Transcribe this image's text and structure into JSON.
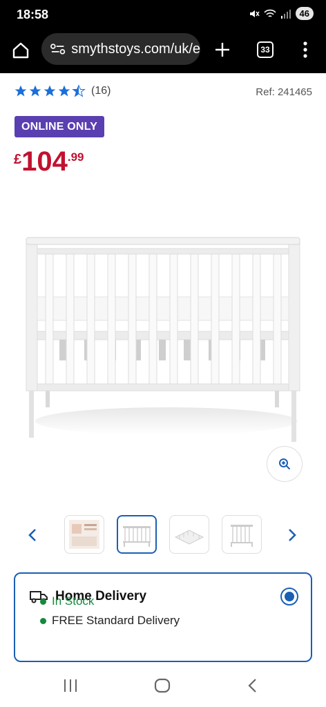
{
  "status_bar": {
    "time": "18:58",
    "battery": "46"
  },
  "browser": {
    "url": "smythstoys.com/uk/e",
    "tab_count": "33"
  },
  "product": {
    "rating": 4.5,
    "review_count": "(16)",
    "ref": "Ref: 241465",
    "badge": "ONLINE ONLY",
    "price": {
      "currency": "£",
      "main": "104",
      "pence": ".99"
    }
  },
  "thumbnails": {
    "selected_index": 1,
    "count": 4
  },
  "delivery": {
    "title": "Home Delivery",
    "stock": "In Stock",
    "shipping": "FREE Standard Delivery",
    "selected": true
  },
  "colors": {
    "accent": "#1a5fb4",
    "price": "#c1112f",
    "badge": "#5a3fb0",
    "stock": "#138a3c",
    "star": "#1a6fd8"
  },
  "icons": [
    "home-icon",
    "site-settings-icon",
    "plus-icon",
    "tab-switcher-icon",
    "more-vert-icon",
    "zoom-in-icon",
    "chevron-left-icon",
    "chevron-right-icon",
    "truck-icon",
    "radio-selected-icon",
    "recent-apps-icon",
    "home-nav-icon",
    "back-icon"
  ]
}
